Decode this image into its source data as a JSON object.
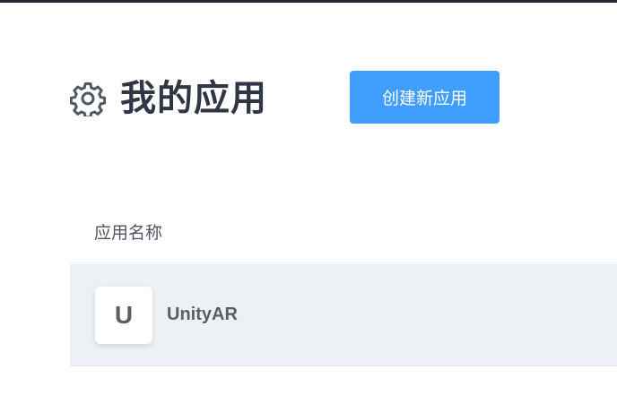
{
  "colors": {
    "accent": "#409eff",
    "top_bar": "#1f2733",
    "row_background": "#edf0f5"
  },
  "header": {
    "icon": "gear-icon",
    "title": "我的应用",
    "create_button_label": "创建新应用"
  },
  "table": {
    "columns": [
      "应用名称"
    ],
    "rows": [
      {
        "avatar_letter": "U",
        "name": "UnityAR"
      }
    ]
  }
}
